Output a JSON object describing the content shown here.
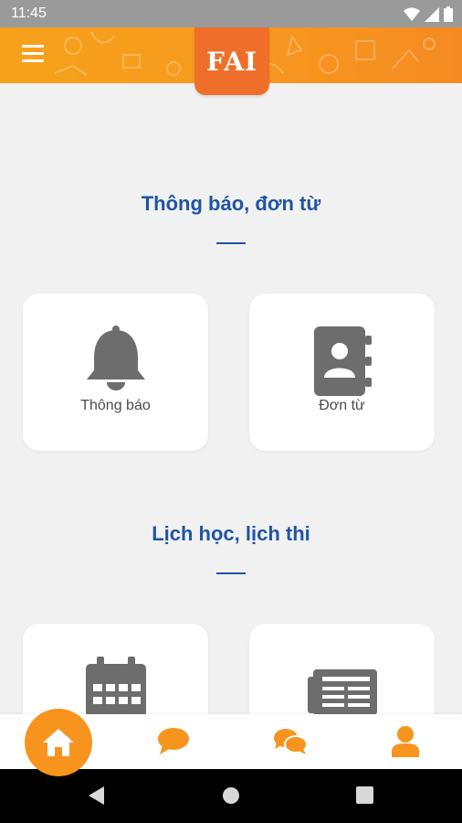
{
  "status_bar": {
    "time": "11:45"
  },
  "header": {
    "logo": "FAI"
  },
  "sections": [
    {
      "title": "Thông báo, đơn từ",
      "cards": [
        {
          "label": "Thông báo",
          "icon": "bell-icon"
        },
        {
          "label": "Đơn từ",
          "icon": "contact-book-icon"
        }
      ]
    },
    {
      "title": "Lịch học, lịch thi",
      "cards": [
        {
          "label": "",
          "icon": "calendar-icon"
        },
        {
          "label": "",
          "icon": "newspaper-icon"
        }
      ]
    }
  ],
  "bottom_nav": {
    "items": [
      {
        "icon": "home-icon",
        "active": true
      },
      {
        "icon": "chat-bubble-icon"
      },
      {
        "icon": "chat-group-icon"
      },
      {
        "icon": "user-icon"
      }
    ]
  },
  "colors": {
    "accent": "#f7941d",
    "title": "#1f55a6",
    "icon_gray": "#6d6d6d"
  }
}
